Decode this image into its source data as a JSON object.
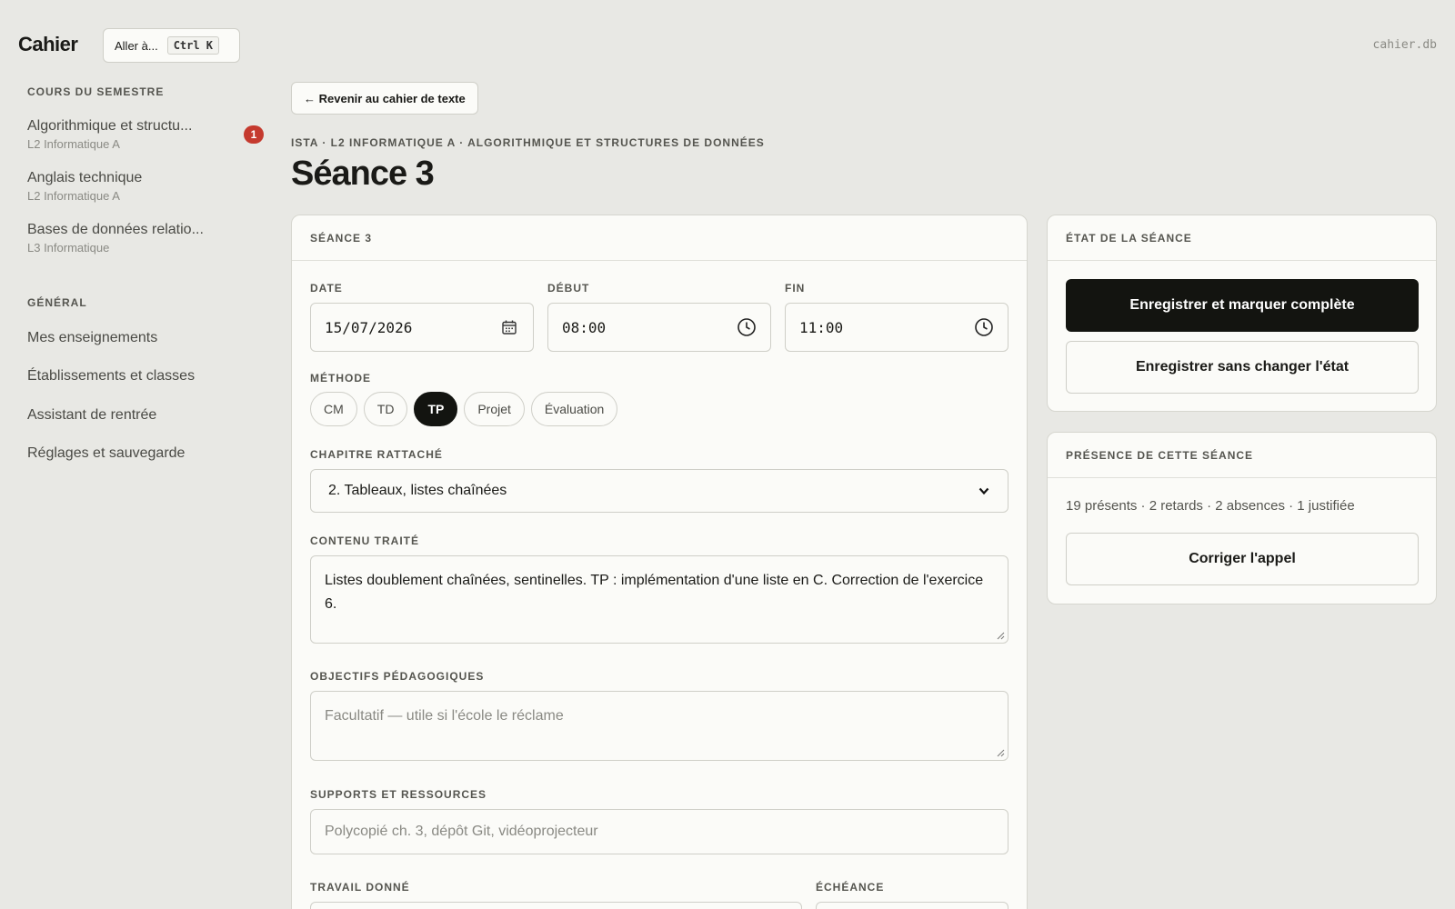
{
  "app": {
    "title": "Cahier",
    "goto_label": "Aller à...",
    "goto_shortcut": "Ctrl K",
    "db_name": "cahier.db"
  },
  "sidebar": {
    "courses_heading": "COURS DU SEMESTRE",
    "courses": [
      {
        "title": "Algorithmique et structu...",
        "subtitle": "L2 Informatique A",
        "badge": "1"
      },
      {
        "title": "Anglais technique",
        "subtitle": "L2 Informatique A"
      },
      {
        "title": "Bases de données relatio...",
        "subtitle": "L3 Informatique"
      }
    ],
    "general_heading": "GÉNÉRAL",
    "nav": [
      {
        "label": "Mes enseignements"
      },
      {
        "label": "Établissements et classes"
      },
      {
        "label": "Assistant de rentrée"
      },
      {
        "label": "Réglages et sauvegarde"
      }
    ]
  },
  "main": {
    "back_label": "← Revenir au cahier de texte",
    "breadcrumb": "ISTA · L2 INFORMATIQUE A · ALGORITHMIQUE ET STRUCTURES DE DONNÉES",
    "title": "Séance 3",
    "form": {
      "card_title": "SÉANCE 3",
      "date_label": "DATE",
      "date_value": "15/07/2026",
      "start_label": "DÉBUT",
      "start_value": "08:00",
      "end_label": "FIN",
      "end_value": "11:00",
      "method_label": "MÉTHODE",
      "methods": [
        {
          "label": "CM",
          "active": false
        },
        {
          "label": "TD",
          "active": false
        },
        {
          "label": "TP",
          "active": true
        },
        {
          "label": "Projet",
          "active": false
        },
        {
          "label": "Évaluation",
          "active": false
        }
      ],
      "chapter_label": "CHAPITRE RATTACHÉ",
      "chapter_value": "2. Tableaux, listes chaînées",
      "content_label": "CONTENU TRAITÉ",
      "content_value": "Listes doublement chaînées, sentinelles. TP : implémentation d'une liste en C. Correction de l'exercice 6.",
      "objectives_label": "OBJECTIFS PÉDAGOGIQUES",
      "objectives_placeholder": "Facultatif — utile si l'école le réclame",
      "resources_label": "SUPPORTS ET RESSOURCES",
      "resources_placeholder": "Polycopié ch. 3, dépôt Git, vidéoprojecteur",
      "homework_label": "TRAVAIL DONNÉ",
      "due_label": "ÉCHÉANCE"
    }
  },
  "state_panel": {
    "title": "ÉTAT DE LA SÉANCE",
    "save_complete_label": "Enregistrer et marquer complète",
    "save_label": "Enregistrer sans changer l'état"
  },
  "presence_panel": {
    "title": "PRÉSENCE DE CETTE SÉANCE",
    "summary": "19 présents · 2 retards · 2 absences · 1 justifiée",
    "correct_label": "Corriger l'appel"
  },
  "colors": {
    "background": "#e8e8e4",
    "card": "#fbfbf8",
    "accent_dark": "#131410",
    "badge": "#c53a2e"
  }
}
